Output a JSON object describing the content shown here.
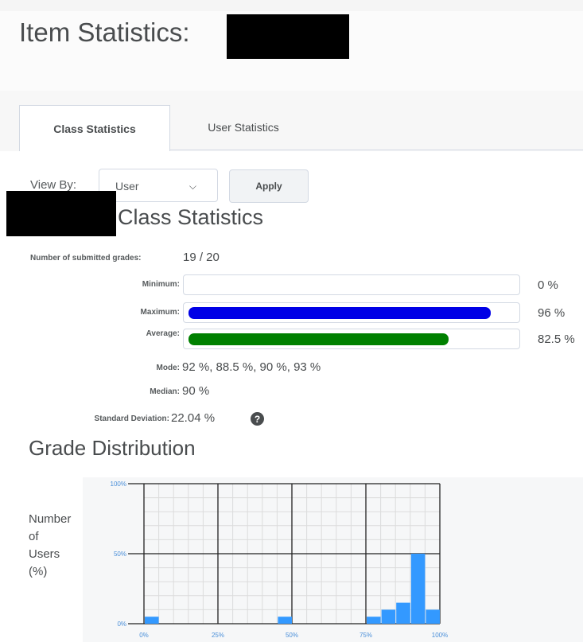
{
  "page": {
    "title": "Item Statistics:"
  },
  "tabs": [
    {
      "label": "Class Statistics",
      "active": true
    },
    {
      "label": "User Statistics",
      "active": false
    }
  ],
  "view_by": {
    "label": "View By:",
    "selected": "User",
    "apply_label": "Apply"
  },
  "section_heading": "Class Statistics",
  "stats": {
    "submitted_label": "Number of submitted grades:",
    "submitted_value": "19 / 20",
    "minimum_label": "Minimum:",
    "minimum_value": "0 %",
    "minimum_fraction": 0,
    "maximum_label": "Maximum:",
    "maximum_value": "96 %",
    "maximum_fraction": 0.96,
    "average_label": "Average:",
    "average_value": "82.5 %",
    "average_fraction": 0.825,
    "mode_label": "Mode:",
    "mode_value": "92 %, 88.5 %, 90 %, 93 %",
    "median_label": "Median:",
    "median_value": "90 %",
    "stddev_label": "Standard Deviation:",
    "stddev_value": "22.04 %"
  },
  "colors": {
    "maximum_bar": "#0000e6",
    "average_bar": "#008000",
    "histogram_bar": "#3399ff"
  },
  "distribution": {
    "heading": "Grade Distribution",
    "y_axis_title": [
      "Number",
      "of",
      "Users",
      "(%)"
    ]
  },
  "chart_data": {
    "type": "bar",
    "title": "",
    "xlabel": "",
    "ylabel": "Number of Users (%)",
    "x_ticks": [
      "0%",
      "25%",
      "50%",
      "75%",
      "100%"
    ],
    "y_ticks": [
      "0%",
      "50%",
      "100%"
    ],
    "xlim": [
      0,
      100
    ],
    "ylim": [
      0,
      100
    ],
    "grid": true,
    "bin_width": 5,
    "bins_start": [
      0,
      45,
      75,
      80,
      85,
      90,
      95
    ],
    "values": [
      5,
      5,
      5,
      10,
      15,
      50,
      10
    ]
  }
}
